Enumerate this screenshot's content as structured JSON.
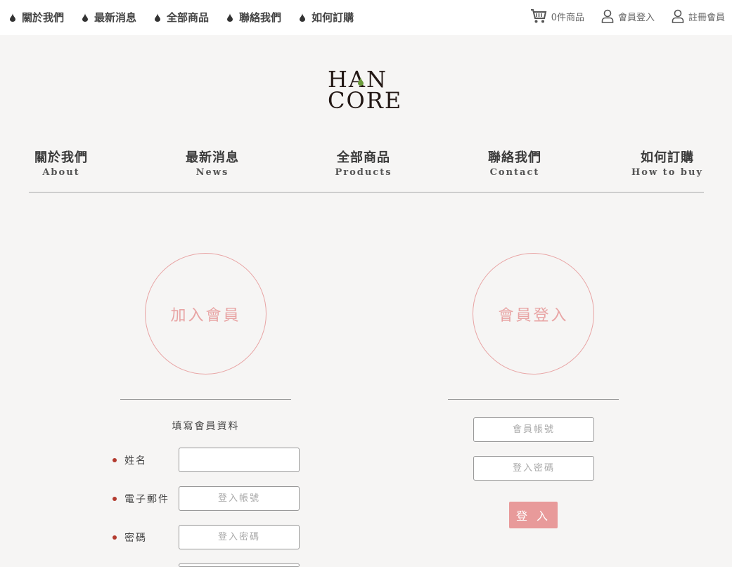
{
  "topnav": {
    "items": [
      {
        "label": "關於我們"
      },
      {
        "label": "最新消息"
      },
      {
        "label": "全部商品"
      },
      {
        "label": "聯絡我們"
      },
      {
        "label": "如何訂購"
      }
    ]
  },
  "utility": {
    "cart_label": "0件商品",
    "login_label": "會員登入",
    "register_label": "註冊會員"
  },
  "logo": {
    "line1": "HAN",
    "line2": "CORE"
  },
  "mainnav": {
    "items": [
      {
        "zh": "關於我們",
        "en": "About"
      },
      {
        "zh": "最新消息",
        "en": "News"
      },
      {
        "zh": "全部商品",
        "en": "Products"
      },
      {
        "zh": "聯絡我們",
        "en": "Contact"
      },
      {
        "zh": "如何訂購",
        "en": "How to buy"
      }
    ]
  },
  "register": {
    "heading": "加入會員",
    "form_title": "填寫會員資料",
    "fields": [
      {
        "label": "姓名",
        "placeholder": ""
      },
      {
        "label": "電子郵件",
        "placeholder": "登入帳號"
      },
      {
        "label": "密碼",
        "placeholder": "登入密碼"
      }
    ]
  },
  "login": {
    "heading": "會員登入",
    "account_placeholder": "會員帳號",
    "password_placeholder": "登入密碼",
    "submit_label": "登 入"
  },
  "colors": {
    "accent": "#e89a9a",
    "bullet": "#b33a2e",
    "logo_dark": "#231815",
    "logo_green": "#6a9a3a"
  }
}
